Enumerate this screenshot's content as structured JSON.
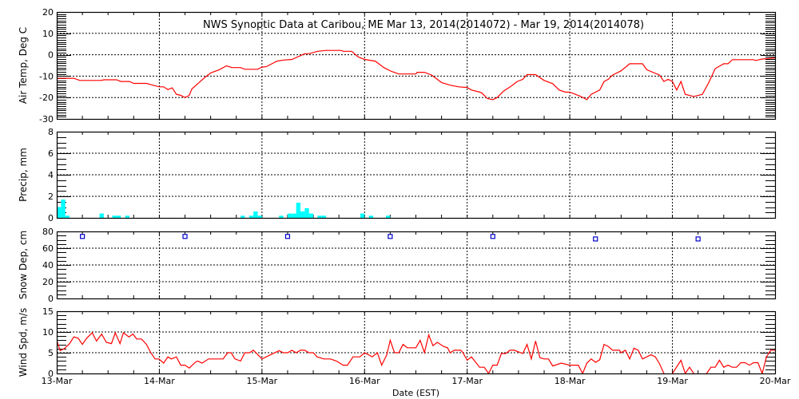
{
  "chart_data": [
    {
      "id": "temp",
      "type": "line",
      "title": "NWS Synoptic Data at Caribou, ME   Mar 13, 2014(2014072) - Mar 19, 2014(2014078)",
      "ylabel": "Air Temp, Deg C",
      "ylim": [
        -30,
        20
      ],
      "yticks": [
        "-30",
        "-20",
        "-10",
        "0",
        "10",
        "20"
      ],
      "minor_step": 1,
      "grid": true,
      "color": "#ff0000",
      "x_unit": "hours since 13-Mar 00:00 EST",
      "points": [
        [
          0,
          -11
        ],
        [
          4,
          -11
        ],
        [
          5.4,
          -12
        ],
        [
          10.4,
          -12
        ],
        [
          11,
          -11.7
        ],
        [
          14,
          -11.7
        ],
        [
          15,
          -12.5
        ],
        [
          17,
          -12.5
        ],
        [
          18,
          -13.4
        ],
        [
          21,
          -13.4
        ],
        [
          22,
          -14
        ],
        [
          24,
          -15
        ],
        [
          25,
          -15
        ],
        [
          26,
          -16.3
        ],
        [
          27,
          -15.5
        ],
        [
          28,
          -18.5
        ],
        [
          29,
          -19
        ],
        [
          30,
          -20
        ],
        [
          31,
          -19
        ],
        [
          31.6,
          -16
        ],
        [
          33,
          -13.5
        ],
        [
          34.4,
          -11
        ],
        [
          36,
          -8.5
        ],
        [
          38,
          -7
        ],
        [
          39.7,
          -5.2
        ],
        [
          41,
          -6
        ],
        [
          43,
          -6
        ],
        [
          44,
          -6.8
        ],
        [
          47,
          -6.8
        ],
        [
          48,
          -5.8
        ],
        [
          49,
          -5.6
        ],
        [
          51.5,
          -3
        ],
        [
          53,
          -2.5
        ],
        [
          55,
          -2.2
        ],
        [
          58,
          0.5
        ],
        [
          59,
          0.5
        ],
        [
          61,
          1.6
        ],
        [
          63,
          2
        ],
        [
          66.5,
          2
        ],
        [
          67,
          1.6
        ],
        [
          69,
          1.6
        ],
        [
          70.5,
          -1
        ],
        [
          72,
          -2.2
        ],
        [
          74.5,
          -3
        ],
        [
          76.5,
          -6
        ],
        [
          78.3,
          -7.8
        ],
        [
          80,
          -9
        ],
        [
          84,
          -9
        ],
        [
          84.3,
          -8.2
        ],
        [
          86,
          -8.2
        ],
        [
          87.7,
          -9.5
        ],
        [
          90,
          -13
        ],
        [
          92,
          -14.2
        ],
        [
          94,
          -15
        ],
        [
          96,
          -15.3
        ],
        [
          97,
          -16.5
        ],
        [
          99,
          -17.5
        ],
        [
          99.5,
          -18
        ],
        [
          100.7,
          -20.5
        ],
        [
          102,
          -21
        ],
        [
          103,
          -20
        ],
        [
          104.5,
          -17
        ],
        [
          106.4,
          -14.5
        ],
        [
          107.7,
          -12.5
        ],
        [
          109,
          -11.5
        ],
        [
          110,
          -9.3
        ],
        [
          112,
          -9.3
        ],
        [
          114,
          -12
        ],
        [
          116,
          -13.5
        ],
        [
          117.5,
          -16.5
        ],
        [
          119,
          -17.5
        ],
        [
          120,
          -17.5
        ],
        [
          122.6,
          -19.5
        ],
        [
          124,
          -21
        ],
        [
          125,
          -18.5
        ],
        [
          127,
          -16.5
        ],
        [
          128,
          -12.5
        ],
        [
          129,
          -11.5
        ],
        [
          130,
          -9.5
        ],
        [
          132,
          -7.5
        ],
        [
          134,
          -4.2
        ],
        [
          137,
          -4.2
        ],
        [
          138,
          -7
        ],
        [
          141,
          -9.5
        ],
        [
          142,
          -12.5
        ],
        [
          143,
          -11.5
        ],
        [
          144,
          -12.5
        ],
        [
          145,
          -16.5
        ],
        [
          146,
          -12.5
        ],
        [
          147,
          -18.5
        ],
        [
          149,
          -19.5
        ],
        [
          151,
          -18.5
        ],
        [
          152.5,
          -13
        ],
        [
          154,
          -6.5
        ],
        [
          156,
          -4.2
        ],
        [
          157,
          -4.2
        ],
        [
          158,
          -2.3
        ],
        [
          163,
          -2.3
        ],
        [
          163.5,
          -2.7
        ],
        [
          165,
          -2
        ],
        [
          168,
          -1.5
        ]
      ]
    },
    {
      "id": "precip",
      "type": "bar",
      "ylabel": "Precip, mm",
      "ylim": [
        0,
        8
      ],
      "yticks": [
        "0",
        "2",
        "4",
        "6",
        "8"
      ],
      "minor_step": 0.5,
      "grid": true,
      "color": "#00ffff",
      "bin_hours": 1,
      "bars": [
        [
          0,
          1.0
        ],
        [
          1,
          1.7
        ],
        [
          2,
          0.2
        ],
        [
          10,
          0.4
        ],
        [
          13,
          0.2
        ],
        [
          14,
          0.2
        ],
        [
          16,
          0.2
        ],
        [
          43,
          0.2
        ],
        [
          45,
          0.2
        ],
        [
          46,
          0.6
        ],
        [
          47,
          0.2
        ],
        [
          52,
          0.2
        ],
        [
          54,
          0.4
        ],
        [
          55,
          0.4
        ],
        [
          56,
          1.4
        ],
        [
          57,
          0.6
        ],
        [
          58,
          0.9
        ],
        [
          59,
          0.4
        ],
        [
          61,
          0.2
        ],
        [
          62,
          0.2
        ],
        [
          71,
          0.4
        ],
        [
          73,
          0.2
        ],
        [
          77,
          0.2
        ]
      ]
    },
    {
      "id": "snow",
      "type": "scatter",
      "ylabel": "Snow Dep, cm",
      "ylim": [
        0,
        80
      ],
      "yticks": [
        "0",
        "20",
        "40",
        "60",
        "80"
      ],
      "minor_step": 5,
      "grid": true,
      "color": "#0000cc",
      "points": [
        [
          6,
          74
        ],
        [
          30,
          74
        ],
        [
          54,
          74
        ],
        [
          78,
          74
        ],
        [
          102,
          74
        ],
        [
          126,
          71
        ],
        [
          150,
          71
        ]
      ]
    },
    {
      "id": "wind",
      "type": "line",
      "ylabel": "Wind Spd, m/s",
      "xlabel": "Date (EST)",
      "ylim": [
        0,
        15
      ],
      "yticks": [
        "0",
        "5",
        "10",
        "15"
      ],
      "xticks": [
        "13-Mar",
        "14-Mar",
        "15-Mar",
        "16-Mar",
        "17-Mar",
        "18-Mar",
        "19-Mar",
        "20-Mar"
      ],
      "minor_step": 1,
      "grid": true,
      "color": "#ff0000",
      "points": [
        [
          0,
          8
        ],
        [
          0.8,
          5.5
        ],
        [
          1.8,
          6
        ],
        [
          3,
          7.2
        ],
        [
          4,
          8.8
        ],
        [
          5,
          8.5
        ],
        [
          6,
          7
        ],
        [
          7,
          8.5
        ],
        [
          8.3,
          9.8
        ],
        [
          9.3,
          7.8
        ],
        [
          10.5,
          9.5
        ],
        [
          11.6,
          7.5
        ],
        [
          12.8,
          7.2
        ],
        [
          13.7,
          9.8
        ],
        [
          14.8,
          7.2
        ],
        [
          15.6,
          9.8
        ],
        [
          16.9,
          8.8
        ],
        [
          17.8,
          9.5
        ],
        [
          18.7,
          8.3
        ],
        [
          19.8,
          8.3
        ],
        [
          21,
          7
        ],
        [
          22,
          5
        ],
        [
          23,
          3.5
        ],
        [
          23.9,
          3.5
        ],
        [
          25,
          2.5
        ],
        [
          26,
          4
        ],
        [
          26.8,
          3.5
        ],
        [
          28,
          4
        ],
        [
          29,
          2
        ],
        [
          30,
          2
        ],
        [
          31,
          1.3
        ],
        [
          32.4,
          2.7
        ],
        [
          33,
          3
        ],
        [
          34,
          2.5
        ],
        [
          35.5,
          3.5
        ],
        [
          38.9,
          3.5
        ],
        [
          40,
          5
        ],
        [
          40.8,
          5
        ],
        [
          41.7,
          3.5
        ],
        [
          43,
          3
        ],
        [
          44,
          5
        ],
        [
          45.1,
          5
        ],
        [
          46,
          5.6
        ],
        [
          48,
          3.5
        ],
        [
          50,
          4.5
        ],
        [
          52,
          5.5
        ],
        [
          53,
          5
        ],
        [
          54,
          5
        ],
        [
          55,
          5.6
        ],
        [
          56,
          5
        ],
        [
          57,
          5.6
        ],
        [
          58,
          5.6
        ],
        [
          59,
          5
        ],
        [
          60,
          5
        ],
        [
          60.9,
          4
        ],
        [
          62.5,
          3.5
        ],
        [
          64,
          3.5
        ],
        [
          65.4,
          3
        ],
        [
          67,
          2
        ],
        [
          68,
          2
        ],
        [
          69.3,
          4
        ],
        [
          70.9,
          4
        ],
        [
          72,
          5
        ],
        [
          73.8,
          4
        ],
        [
          75,
          5
        ],
        [
          76,
          2
        ],
        [
          77.2,
          4.5
        ],
        [
          78,
          8
        ],
        [
          79,
          5
        ],
        [
          80,
          5
        ],
        [
          81,
          7
        ],
        [
          82,
          6.2
        ],
        [
          83,
          6.2
        ],
        [
          84,
          6.2
        ],
        [
          85,
          8
        ],
        [
          86,
          5
        ],
        [
          87,
          9.3
        ],
        [
          88,
          6.7
        ],
        [
          89,
          7.5
        ],
        [
          90.5,
          6.5
        ],
        [
          91.4,
          6.2
        ],
        [
          92,
          5
        ],
        [
          93,
          5.6
        ],
        [
          94.5,
          5.6
        ],
        [
          95,
          5
        ],
        [
          96,
          3.2
        ],
        [
          97,
          4
        ],
        [
          98.9,
          1.5
        ],
        [
          100,
          1.5
        ],
        [
          101,
          0
        ],
        [
          102,
          2
        ],
        [
          103,
          2
        ],
        [
          104,
          4.8
        ],
        [
          105,
          4.8
        ],
        [
          106,
          5.6
        ],
        [
          107,
          5.6
        ],
        [
          109,
          4.8
        ],
        [
          110,
          7
        ],
        [
          111,
          3.5
        ],
        [
          112,
          7.8
        ],
        [
          113,
          3.8
        ],
        [
          114,
          3.5
        ],
        [
          115,
          3.5
        ],
        [
          116,
          1.8
        ],
        [
          118,
          2.5
        ],
        [
          120,
          2
        ],
        [
          122,
          2
        ],
        [
          123,
          0
        ],
        [
          124,
          2.5
        ],
        [
          125,
          3.5
        ],
        [
          126,
          2.7
        ],
        [
          127,
          3.3
        ],
        [
          128,
          7
        ],
        [
          129,
          6.5
        ],
        [
          130,
          5.6
        ],
        [
          131.6,
          5.6
        ],
        [
          132,
          5
        ],
        [
          133,
          5.6
        ],
        [
          134,
          3.5
        ],
        [
          135,
          6.1
        ],
        [
          136,
          5.6
        ],
        [
          137,
          3.5
        ],
        [
          139,
          4.5
        ],
        [
          140,
          4
        ],
        [
          141,
          2.3
        ],
        [
          142,
          0
        ],
        [
          143,
          -1
        ],
        [
          144,
          0
        ],
        [
          146,
          3.2
        ],
        [
          147,
          0
        ],
        [
          148,
          1.5
        ],
        [
          149,
          0
        ],
        [
          150,
          -1
        ],
        [
          151,
          -1
        ],
        [
          152,
          0
        ],
        [
          153,
          1.5
        ],
        [
          154,
          1.5
        ],
        [
          155,
          3.2
        ],
        [
          156,
          1.5
        ],
        [
          157,
          2
        ],
        [
          158,
          1.5
        ],
        [
          159,
          1.5
        ],
        [
          160,
          2.6
        ],
        [
          161,
          2.6
        ],
        [
          162,
          2
        ],
        [
          163,
          2.6
        ],
        [
          164,
          2.6
        ],
        [
          165,
          0
        ],
        [
          166,
          4
        ],
        [
          167,
          5.6
        ],
        [
          168,
          5.6
        ]
      ]
    }
  ]
}
